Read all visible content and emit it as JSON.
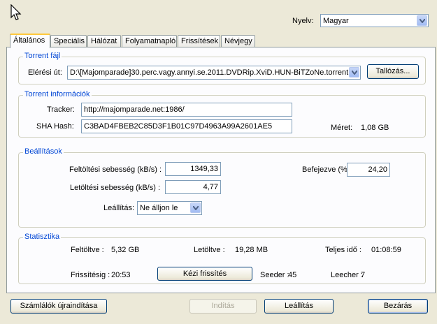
{
  "language": {
    "label": "Nyelv:",
    "value": "Magyar"
  },
  "tabs": [
    "Általános",
    "Speciális",
    "Hálózat",
    "Folyamatnapló",
    "Frissítések",
    "Névjegy"
  ],
  "torrent_file": {
    "title": "Torrent fájl",
    "path_label": "Elérési út:",
    "path_value": "D:\\[Majomparade]30.perc.vagy.annyi.se.2011.DVDRip.XviD.HUN-BiTZoNe.torrent",
    "browse_button": "Tallózás..."
  },
  "torrent_info": {
    "title": "Torrent információk",
    "tracker_label": "Tracker:",
    "tracker_value": "http://majomparade.net:1986/",
    "hash_label": "SHA Hash:",
    "hash_value": "C3BAD4FBEB2C85D3F1B01C97D4963A99A2601AE5",
    "size_label": "Méret:",
    "size_value": "1,08 GB"
  },
  "settings": {
    "title": "Beállítások",
    "upload_label": "Feltöltési sebesség (kB/s) :",
    "upload_value": "1349,33",
    "download_label": "Letöltési sebesség (kB/s) :",
    "download_value": "4,77",
    "done_label": "Befejezve (%)",
    "done_value": "24,20",
    "stop_label": "Leállítás:",
    "stop_value": "Ne álljon le"
  },
  "stats": {
    "title": "Statisztika",
    "uploaded_label": "Feltöltve :",
    "uploaded_value": "5,32 GB",
    "downloaded_label": "Letöltve :",
    "downloaded_value": "19,28 MB",
    "total_time_label": "Teljes idő :",
    "total_time_value": "01:08:59",
    "refresh_label": "Frissítésig :",
    "refresh_value": "20:53",
    "manual_refresh_button": "Kézi frissítés",
    "seeder_label": "Seeder :",
    "seeder_value": "45",
    "leecher_label": "Leecher :",
    "leecher_value": "7"
  },
  "footer": {
    "reset_button": "Számlálók újraindítása",
    "start_button": "Indítás",
    "stop_button": "Leállítás",
    "close_button": "Bezárás"
  }
}
